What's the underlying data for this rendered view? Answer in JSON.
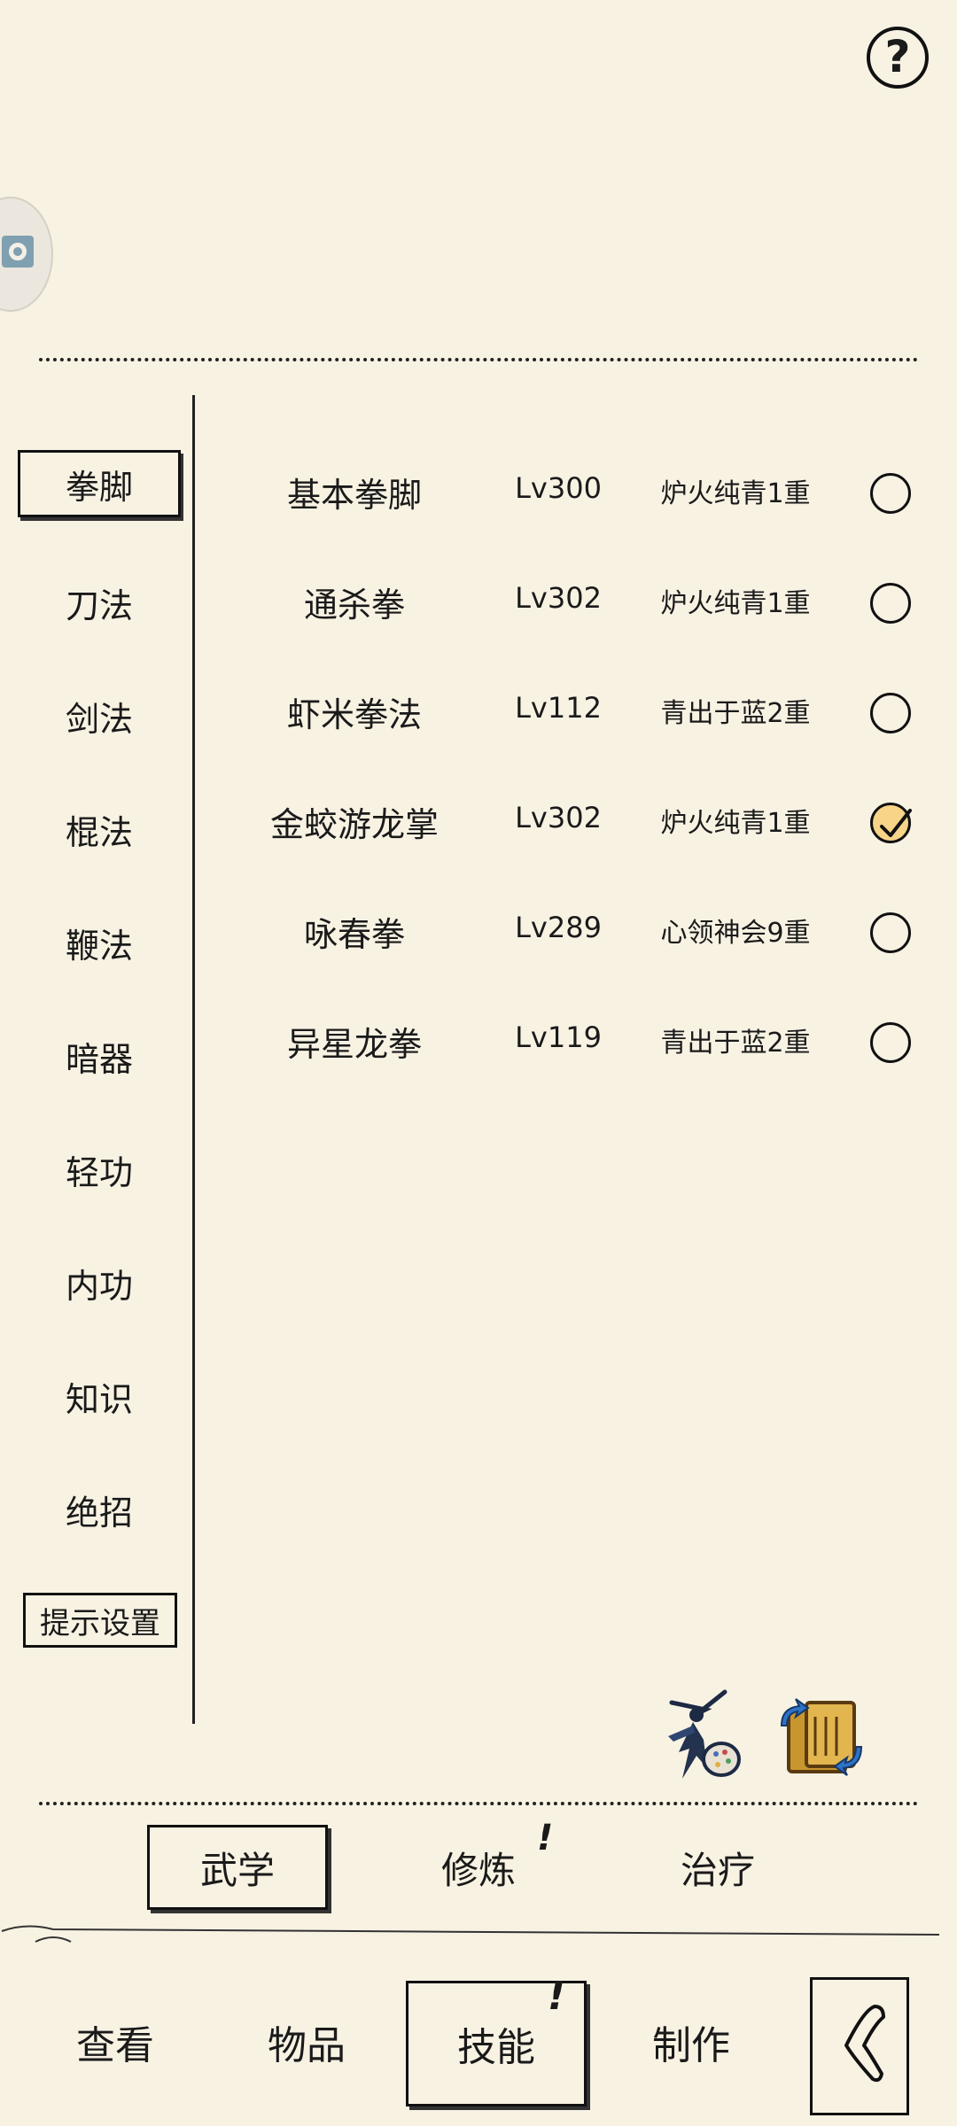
{
  "help": {
    "label": "?"
  },
  "categories": [
    {
      "label": "拳脚",
      "active": true
    },
    {
      "label": "刀法",
      "active": false
    },
    {
      "label": "剑法",
      "active": false
    },
    {
      "label": "棍法",
      "active": false
    },
    {
      "label": "鞭法",
      "active": false
    },
    {
      "label": "暗器",
      "active": false
    },
    {
      "label": "轻功",
      "active": false
    },
    {
      "label": "内功",
      "active": false
    },
    {
      "label": "知识",
      "active": false
    },
    {
      "label": "绝招",
      "active": false
    }
  ],
  "hint_settings_label": "提示设置",
  "skills": [
    {
      "name": "基本拳脚",
      "level": "Lv300",
      "rank": "炉火纯青1重",
      "selected": false
    },
    {
      "name": "通杀拳",
      "level": "Lv302",
      "rank": "炉火纯青1重",
      "selected": false
    },
    {
      "name": "虾米拳法",
      "level": "Lv112",
      "rank": "青出于蓝2重",
      "selected": false
    },
    {
      "name": "金蛟游龙掌",
      "level": "Lv302",
      "rank": "炉火纯青1重",
      "selected": true
    },
    {
      "name": "咏春拳",
      "level": "Lv289",
      "rank": "心领神会9重",
      "selected": false
    },
    {
      "name": "异星龙拳",
      "level": "Lv119",
      "rank": "青出于蓝2重",
      "selected": false
    }
  ],
  "subtabs": [
    {
      "label": "武学",
      "active": true,
      "badge": ""
    },
    {
      "label": "修炼",
      "active": false,
      "badge": "!"
    },
    {
      "label": "治疗",
      "active": false,
      "badge": ""
    }
  ],
  "nav": [
    {
      "label": "查看",
      "active": false,
      "badge": ""
    },
    {
      "label": "物品",
      "active": false,
      "badge": ""
    },
    {
      "label": "技能",
      "active": true,
      "badge": "!"
    },
    {
      "label": "制作",
      "active": false,
      "badge": ""
    }
  ],
  "icons": {
    "help": "question-icon",
    "martial_artist": "martial-artist-icon",
    "scroll_swap": "scroll-swap-icon",
    "back": "back-arrow-icon",
    "side_chip": "app-logo-icon"
  },
  "colors": {
    "background": "#f8f2e3",
    "ink": "#1a1a1a",
    "check_fill": "#f7d488"
  }
}
